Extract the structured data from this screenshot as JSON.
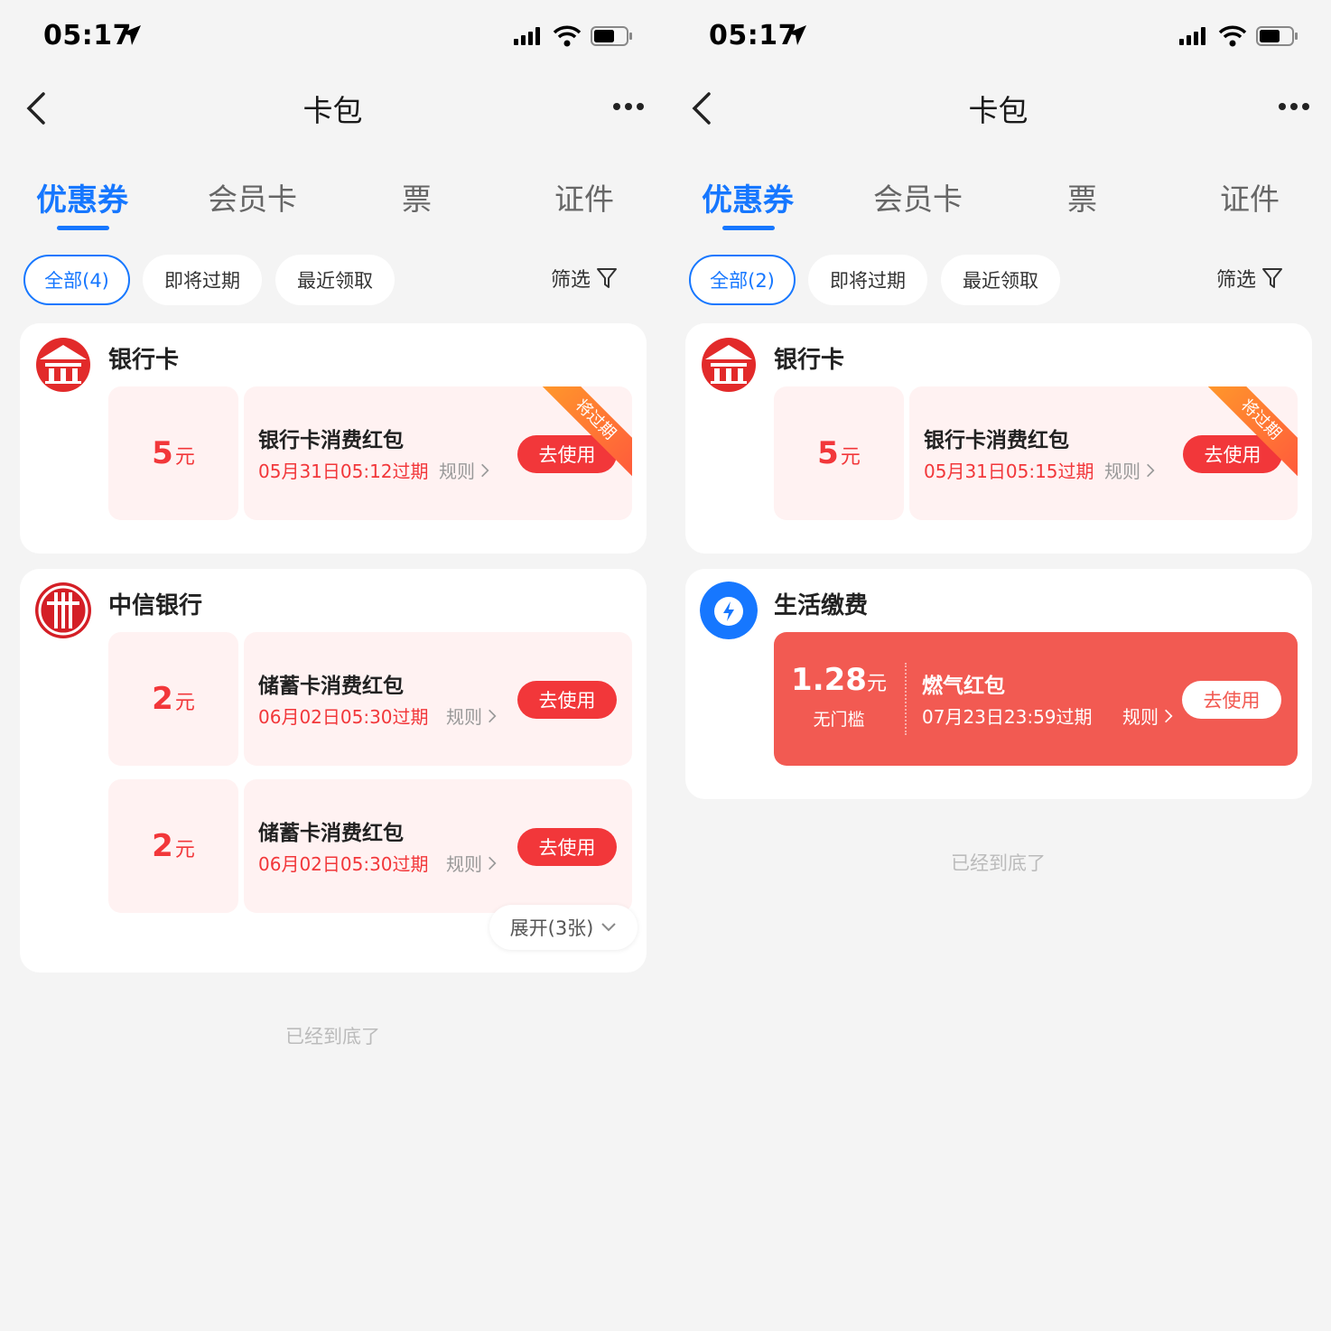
{
  "screens": [
    {
      "status_time": "05:17",
      "nav_title": "卡包",
      "tabs": [
        "优惠券",
        "会员卡",
        "票",
        "证件"
      ],
      "chips": [
        "全部(4)",
        "即将过期",
        "最近领取"
      ],
      "filter_label": "筛选",
      "cards": [
        {
          "merchant": "银行卡",
          "logo": "bank-icon",
          "coupons": [
            {
              "amount": "5",
              "unit": "元",
              "title": "银行卡消费红包",
              "expire": "05月31日05:12过期",
              "rule": "规则",
              "action": "去使用",
              "badge": "将过期"
            }
          ]
        },
        {
          "merchant": "中信银行",
          "logo": "citic-icon",
          "coupons": [
            {
              "amount": "2",
              "unit": "元",
              "title": "储蓄卡消费红包",
              "expire": "06月02日05:30过期",
              "rule": "规则",
              "action": "去使用"
            },
            {
              "amount": "2",
              "unit": "元",
              "title": "储蓄卡消费红包",
              "expire": "06月02日05:30过期",
              "rule": "规则",
              "action": "去使用"
            }
          ],
          "expand_label": "展开(3张)"
        }
      ],
      "bottom_hint": "已经到底了"
    },
    {
      "status_time": "05:17",
      "nav_title": "卡包",
      "tabs": [
        "优惠券",
        "会员卡",
        "票",
        "证件"
      ],
      "chips": [
        "全部(2)",
        "即将过期",
        "最近领取"
      ],
      "filter_label": "筛选",
      "cards": [
        {
          "merchant": "银行卡",
          "logo": "bank-icon",
          "coupons": [
            {
              "amount": "5",
              "unit": "元",
              "title": "银行卡消费红包",
              "expire": "05月31日05:15过期",
              "rule": "规则",
              "action": "去使用",
              "badge": "将过期"
            }
          ]
        },
        {
          "merchant": "生活缴费",
          "logo": "utility-lightning-icon",
          "coupons": [
            {
              "amount": "1.28",
              "unit": "元",
              "threshold": "无门槛",
              "title": "燃气红包",
              "expire": "07月23日23:59过期",
              "rule": "规则",
              "action": "去使用"
            }
          ]
        }
      ],
      "bottom_hint": "已经到底了"
    }
  ],
  "colors": {
    "accent_blue": "#1677ff",
    "red": "#f2373a",
    "coupon_bg": "#fff2f2",
    "gas_coupon": "#f25a52"
  }
}
